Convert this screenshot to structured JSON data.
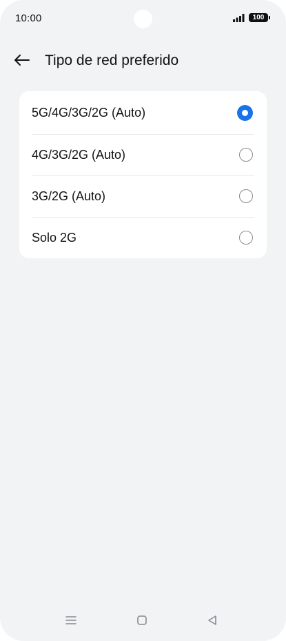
{
  "status_bar": {
    "time": "10:00",
    "battery": "100",
    "signal_icon": "signal-icon"
  },
  "header": {
    "back_icon": "arrow-left-icon",
    "title": "Tipo de red preferido"
  },
  "options": [
    {
      "label": "5G/4G/3G/2G (Auto)",
      "selected": true
    },
    {
      "label": "4G/3G/2G (Auto)",
      "selected": false
    },
    {
      "label": "3G/2G (Auto)",
      "selected": false
    },
    {
      "label": "Solo 2G",
      "selected": false
    }
  ],
  "nav_bar": {
    "icons": [
      "menu-icon",
      "home-square-icon",
      "back-triangle-icon"
    ]
  },
  "colors": {
    "background": "#f2f3f5",
    "card": "#ffffff",
    "accent": "#1a73e8",
    "text": "#111111"
  }
}
